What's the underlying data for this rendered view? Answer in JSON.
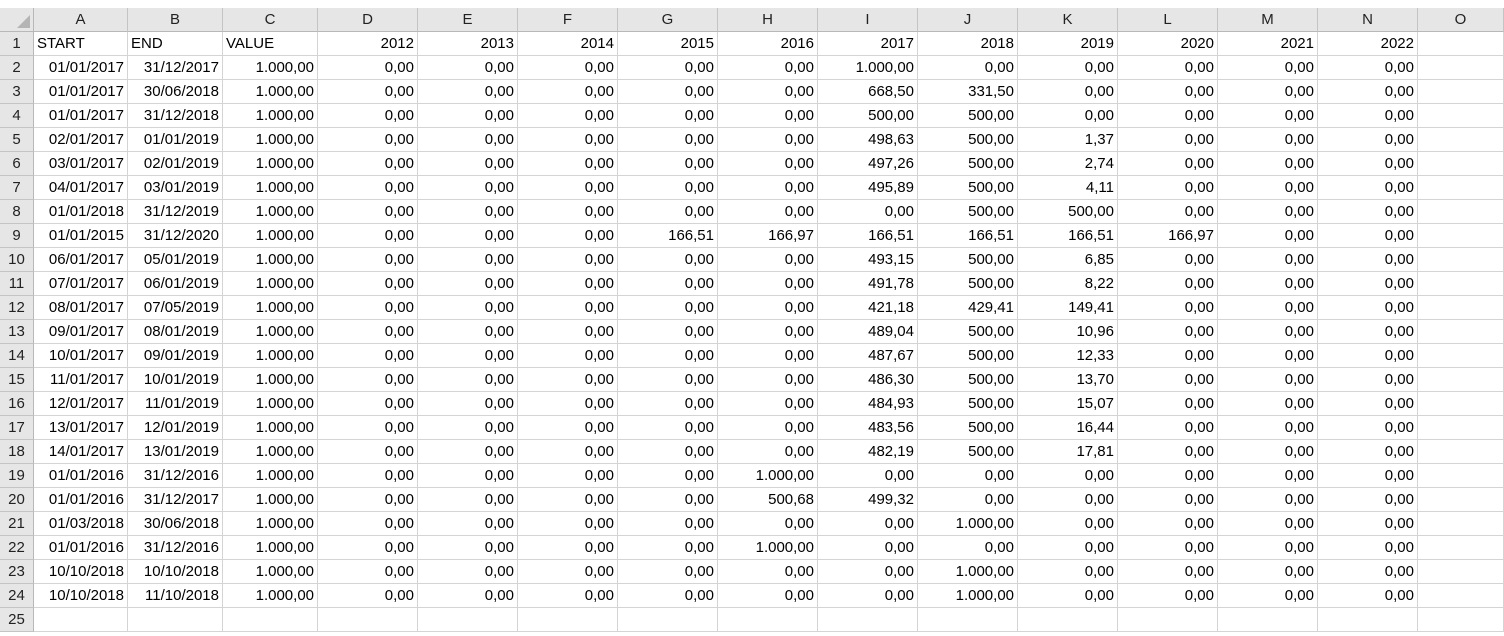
{
  "columns": [
    "A",
    "B",
    "C",
    "D",
    "E",
    "F",
    "G",
    "H",
    "I",
    "J",
    "K",
    "L",
    "M",
    "N",
    "O"
  ],
  "row_numbers": [
    "1",
    "2",
    "3",
    "4",
    "5",
    "6",
    "7",
    "8",
    "9",
    "10",
    "11",
    "12",
    "13",
    "14",
    "15",
    "16",
    "17",
    "18",
    "19",
    "20",
    "21",
    "22",
    "23",
    "24",
    "25"
  ],
  "header_row": [
    "START",
    "END",
    "VALUE",
    "2012",
    "2013",
    "2014",
    "2015",
    "2016",
    "2017",
    "2018",
    "2019",
    "2020",
    "2021",
    "2022",
    ""
  ],
  "rows": [
    [
      "01/01/2017",
      "31/12/2017",
      "1.000,00",
      "0,00",
      "0,00",
      "0,00",
      "0,00",
      "0,00",
      "1.000,00",
      "0,00",
      "0,00",
      "0,00",
      "0,00",
      "0,00",
      ""
    ],
    [
      "01/01/2017",
      "30/06/2018",
      "1.000,00",
      "0,00",
      "0,00",
      "0,00",
      "0,00",
      "0,00",
      "668,50",
      "331,50",
      "0,00",
      "0,00",
      "0,00",
      "0,00",
      ""
    ],
    [
      "01/01/2017",
      "31/12/2018",
      "1.000,00",
      "0,00",
      "0,00",
      "0,00",
      "0,00",
      "0,00",
      "500,00",
      "500,00",
      "0,00",
      "0,00",
      "0,00",
      "0,00",
      ""
    ],
    [
      "02/01/2017",
      "01/01/2019",
      "1.000,00",
      "0,00",
      "0,00",
      "0,00",
      "0,00",
      "0,00",
      "498,63",
      "500,00",
      "1,37",
      "0,00",
      "0,00",
      "0,00",
      ""
    ],
    [
      "03/01/2017",
      "02/01/2019",
      "1.000,00",
      "0,00",
      "0,00",
      "0,00",
      "0,00",
      "0,00",
      "497,26",
      "500,00",
      "2,74",
      "0,00",
      "0,00",
      "0,00",
      ""
    ],
    [
      "04/01/2017",
      "03/01/2019",
      "1.000,00",
      "0,00",
      "0,00",
      "0,00",
      "0,00",
      "0,00",
      "495,89",
      "500,00",
      "4,11",
      "0,00",
      "0,00",
      "0,00",
      ""
    ],
    [
      "01/01/2018",
      "31/12/2019",
      "1.000,00",
      "0,00",
      "0,00",
      "0,00",
      "0,00",
      "0,00",
      "0,00",
      "500,00",
      "500,00",
      "0,00",
      "0,00",
      "0,00",
      ""
    ],
    [
      "01/01/2015",
      "31/12/2020",
      "1.000,00",
      "0,00",
      "0,00",
      "0,00",
      "166,51",
      "166,97",
      "166,51",
      "166,51",
      "166,51",
      "166,97",
      "0,00",
      "0,00",
      ""
    ],
    [
      "06/01/2017",
      "05/01/2019",
      "1.000,00",
      "0,00",
      "0,00",
      "0,00",
      "0,00",
      "0,00",
      "493,15",
      "500,00",
      "6,85",
      "0,00",
      "0,00",
      "0,00",
      ""
    ],
    [
      "07/01/2017",
      "06/01/2019",
      "1.000,00",
      "0,00",
      "0,00",
      "0,00",
      "0,00",
      "0,00",
      "491,78",
      "500,00",
      "8,22",
      "0,00",
      "0,00",
      "0,00",
      ""
    ],
    [
      "08/01/2017",
      "07/05/2019",
      "1.000,00",
      "0,00",
      "0,00",
      "0,00",
      "0,00",
      "0,00",
      "421,18",
      "429,41",
      "149,41",
      "0,00",
      "0,00",
      "0,00",
      ""
    ],
    [
      "09/01/2017",
      "08/01/2019",
      "1.000,00",
      "0,00",
      "0,00",
      "0,00",
      "0,00",
      "0,00",
      "489,04",
      "500,00",
      "10,96",
      "0,00",
      "0,00",
      "0,00",
      ""
    ],
    [
      "10/01/2017",
      "09/01/2019",
      "1.000,00",
      "0,00",
      "0,00",
      "0,00",
      "0,00",
      "0,00",
      "487,67",
      "500,00",
      "12,33",
      "0,00",
      "0,00",
      "0,00",
      ""
    ],
    [
      "11/01/2017",
      "10/01/2019",
      "1.000,00",
      "0,00",
      "0,00",
      "0,00",
      "0,00",
      "0,00",
      "486,30",
      "500,00",
      "13,70",
      "0,00",
      "0,00",
      "0,00",
      ""
    ],
    [
      "12/01/2017",
      "11/01/2019",
      "1.000,00",
      "0,00",
      "0,00",
      "0,00",
      "0,00",
      "0,00",
      "484,93",
      "500,00",
      "15,07",
      "0,00",
      "0,00",
      "0,00",
      ""
    ],
    [
      "13/01/2017",
      "12/01/2019",
      "1.000,00",
      "0,00",
      "0,00",
      "0,00",
      "0,00",
      "0,00",
      "483,56",
      "500,00",
      "16,44",
      "0,00",
      "0,00",
      "0,00",
      ""
    ],
    [
      "14/01/2017",
      "13/01/2019",
      "1.000,00",
      "0,00",
      "0,00",
      "0,00",
      "0,00",
      "0,00",
      "482,19",
      "500,00",
      "17,81",
      "0,00",
      "0,00",
      "0,00",
      ""
    ],
    [
      "01/01/2016",
      "31/12/2016",
      "1.000,00",
      "0,00",
      "0,00",
      "0,00",
      "0,00",
      "1.000,00",
      "0,00",
      "0,00",
      "0,00",
      "0,00",
      "0,00",
      "0,00",
      ""
    ],
    [
      "01/01/2016",
      "31/12/2017",
      "1.000,00",
      "0,00",
      "0,00",
      "0,00",
      "0,00",
      "500,68",
      "499,32",
      "0,00",
      "0,00",
      "0,00",
      "0,00",
      "0,00",
      ""
    ],
    [
      "01/03/2018",
      "30/06/2018",
      "1.000,00",
      "0,00",
      "0,00",
      "0,00",
      "0,00",
      "0,00",
      "0,00",
      "1.000,00",
      "0,00",
      "0,00",
      "0,00",
      "0,00",
      ""
    ],
    [
      "01/01/2016",
      "31/12/2016",
      "1.000,00",
      "0,00",
      "0,00",
      "0,00",
      "0,00",
      "1.000,00",
      "0,00",
      "0,00",
      "0,00",
      "0,00",
      "0,00",
      "0,00",
      ""
    ],
    [
      "10/10/2018",
      "10/10/2018",
      "1.000,00",
      "0,00",
      "0,00",
      "0,00",
      "0,00",
      "0,00",
      "0,00",
      "1.000,00",
      "0,00",
      "0,00",
      "0,00",
      "0,00",
      ""
    ],
    [
      "10/10/2018",
      "11/10/2018",
      "1.000,00",
      "0,00",
      "0,00",
      "0,00",
      "0,00",
      "0,00",
      "0,00",
      "1.000,00",
      "0,00",
      "0,00",
      "0,00",
      "0,00",
      ""
    ],
    [
      "",
      "",
      "",
      "",
      "",
      "",
      "",
      "",
      "",
      "",
      "",
      "",
      "",
      "",
      ""
    ]
  ]
}
